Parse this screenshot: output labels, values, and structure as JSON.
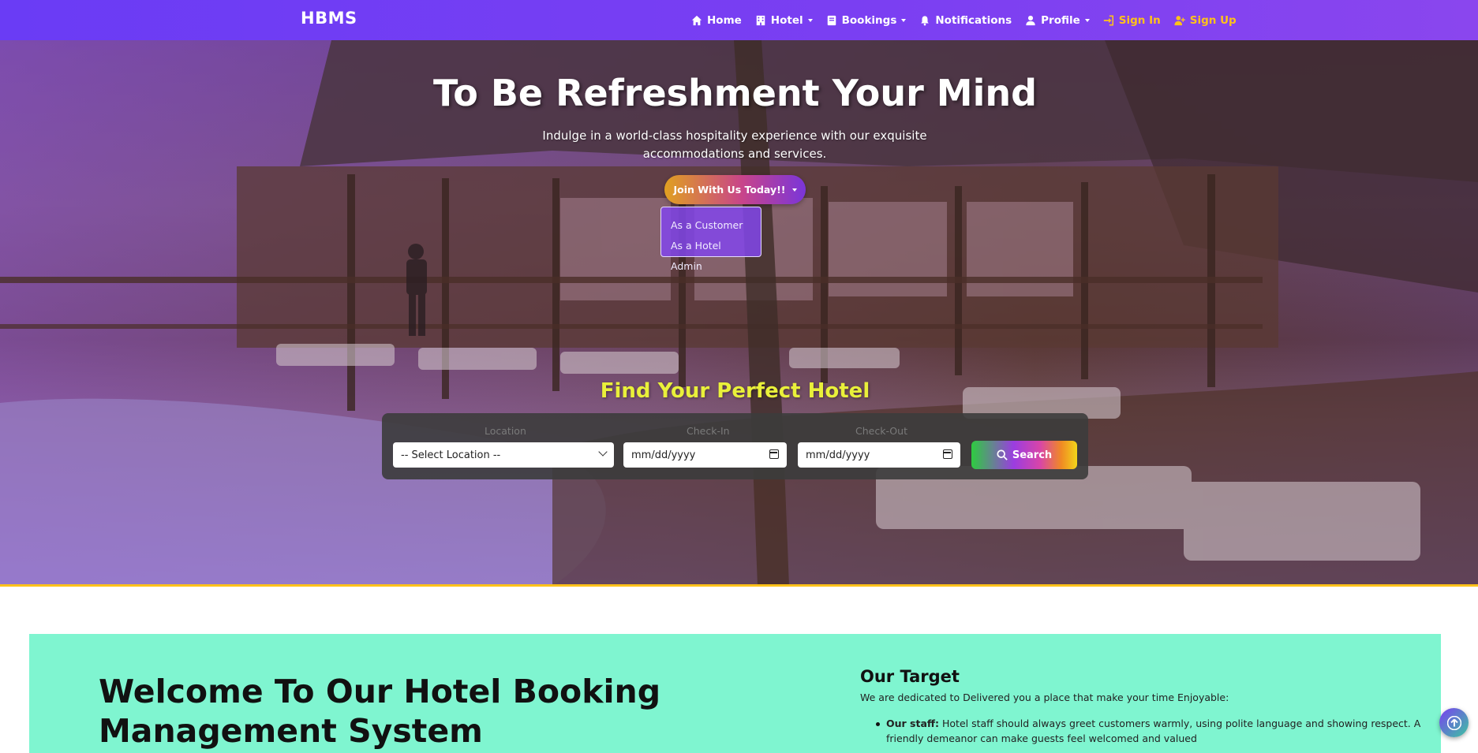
{
  "brand": "HBMS",
  "nav": {
    "home": "Home",
    "hotel": "Hotel",
    "bookings": "Bookings",
    "notifications": "Notifications",
    "profile": "Profile",
    "sign_in": "Sign In",
    "sign_up": "Sign Up"
  },
  "hero": {
    "title": "To Be Refreshment Your Mind",
    "subtitle": "Indulge in a world-class hospitality experience with our exquisite accommodations and services.",
    "join_button": "Join With Us Today!!",
    "join_menu": [
      "As a Customer",
      "As a Hotel Admin"
    ]
  },
  "search": {
    "title": "Find Your Perfect Hotel",
    "location_label": "Location",
    "location_value": "-- Select Location --",
    "checkin_label": "Check-In",
    "checkin_value": "mm/dd/yyyy",
    "checkout_label": "Check-Out",
    "checkout_value": "mm/dd/yyyy",
    "search_button": "Search"
  },
  "welcome": {
    "title": "Welcome To Our Hotel Booking Management System",
    "target_title": "Our Target",
    "target_desc": "We are dedicated to Delivered you a place that make your time Enjoyable:",
    "staff_label": "Our staff:",
    "staff_text": " Hotel staff should always greet customers warmly, using polite language and showing respect. A friendly demeanor can make guests feel welcomed and valued"
  },
  "colors": {
    "navbar": "#6a3cf5",
    "accent_gold": "#ffc21a",
    "find_title": "#e9f03a",
    "welcome_bg": "#7ff5d0"
  },
  "icons": [
    "home-icon",
    "hotel-icon",
    "bookings-icon",
    "bell-icon",
    "user-icon",
    "sign-in-icon",
    "user-plus-icon",
    "search-icon",
    "arrow-up-icon",
    "calendar-icon",
    "chevron-down-icon"
  ]
}
